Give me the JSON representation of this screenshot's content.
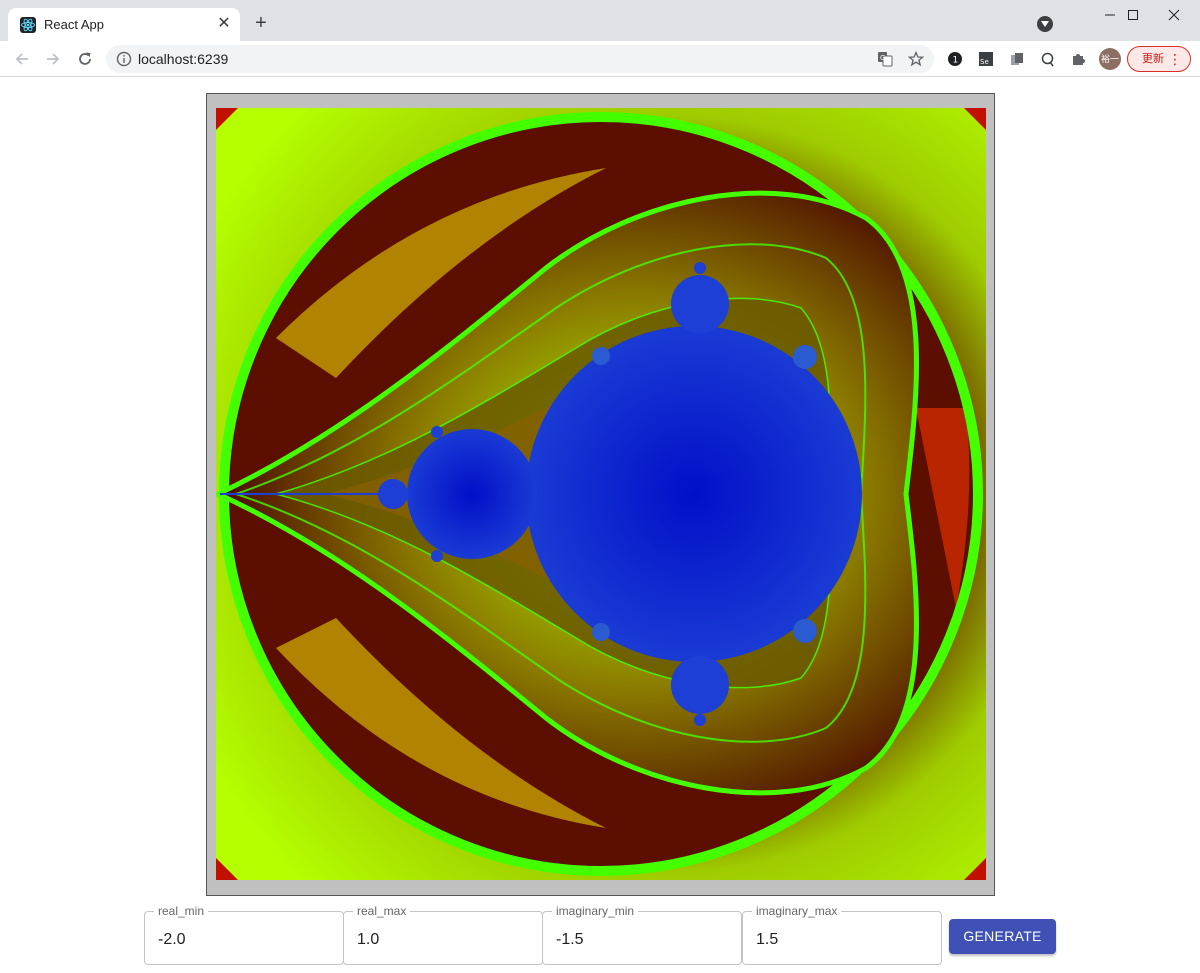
{
  "browser": {
    "tab_title": "React App",
    "tab_close": "✕",
    "new_tab": "+",
    "url": "localhost:6239",
    "avatar_text": "裕一",
    "update_label": "更新",
    "update_menu": "⋮"
  },
  "fields": [
    {
      "label": "real_min",
      "value": "-2.0"
    },
    {
      "label": "real_max",
      "value": "1.0"
    },
    {
      "label": "imaginary_min",
      "value": "-1.5"
    },
    {
      "label": "imaginary_max",
      "value": "1.5"
    }
  ],
  "generate_label": "GENERATE",
  "colors": {
    "set_blue": "#0a2fbf",
    "ring_green": "#44ff00",
    "gradient_yellow": "#b4ff00",
    "dark_red": "#4a0800",
    "button_indigo": "#3f51b5"
  },
  "icons": {
    "tab_favicon": "react-logo-icon",
    "back": "arrow-left-icon",
    "forward": "arrow-right-icon",
    "reload": "reload-icon",
    "info": "info-icon",
    "translate": "translate-icon",
    "bookmark": "star-icon",
    "extensions": "puzzle-icon"
  }
}
